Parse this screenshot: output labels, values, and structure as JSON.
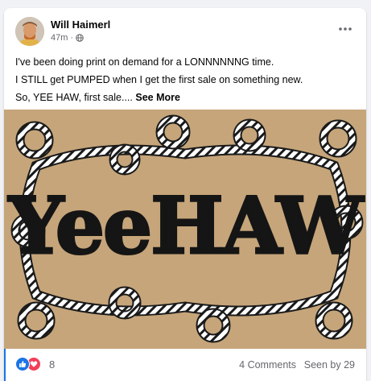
{
  "post": {
    "author": "Will Haimerl",
    "timestamp": "47m",
    "separator": "·",
    "privacy_icon": "globe-icon",
    "more_icon": "more-horizontal-icon",
    "lines": [
      "I've been doing print on demand for a LONNNNNNG time.",
      "I STILL get PUMPED when I get the first sale on something new.",
      "So, YEE HAW, first sale...."
    ],
    "see_more": "See More",
    "image": {
      "text": "YeeHAW",
      "description_icon": "yeehaw-rope-artwork"
    },
    "reactions": {
      "icons": [
        "like-icon",
        "love-icon"
      ],
      "count": "8"
    },
    "comments": "4 Comments",
    "seen_by": "Seen by 29"
  },
  "colors": {
    "accent": "#1b74e4",
    "love": "#f33e58",
    "muted_text": "#65676b",
    "image_bg": "#c9a97d"
  }
}
